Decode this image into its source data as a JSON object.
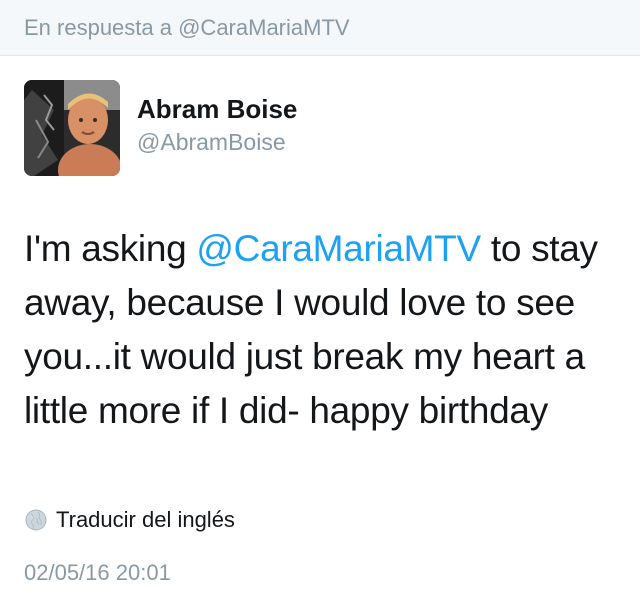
{
  "reply_bar": {
    "text": "En respuesta a @CaraMariaMTV"
  },
  "author": {
    "name": "Abram Boise",
    "handle": "@AbramBoise",
    "avatar_icon": "profile-photo"
  },
  "tweet": {
    "text_before": "I'm asking ",
    "mention": "@CaraMariaMTV",
    "text_after": " to stay away, because I would love to see you...it would just break my heart a little more if I did- happy birthday",
    "mention_color": "#1da1f2"
  },
  "translate": {
    "label": "Traducir del inglés",
    "icon": "globe-icon"
  },
  "timestamp": "02/05/16 20:01"
}
